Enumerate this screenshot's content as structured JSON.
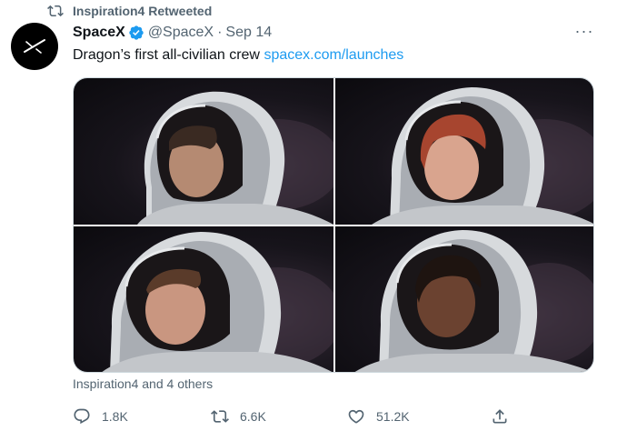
{
  "retweet": {
    "icon": "retweet-icon",
    "text": "Inspiration4 Retweeted"
  },
  "author": {
    "name": "SpaceX",
    "handle": "@SpaceX",
    "separator": "·",
    "date": "Sep 14",
    "verified_icon": "verified-badge-icon",
    "avatar_icon": "spacex-logo-icon"
  },
  "more": {
    "label": "···"
  },
  "tweet": {
    "text": "Dragon’s first all-civilian crew ",
    "link": "spacex.com/launches"
  },
  "media": {
    "photos": [
      "crew-photo-1",
      "crew-photo-2",
      "crew-photo-3",
      "crew-photo-4"
    ]
  },
  "liked_by": "Inspiration4 and 4 others",
  "actions": {
    "reply": {
      "icon": "reply-icon",
      "count": "1.8K"
    },
    "retweet": {
      "icon": "retweet-icon",
      "count": "6.6K"
    },
    "like": {
      "icon": "heart-icon",
      "count": "51.2K"
    },
    "share": {
      "icon": "share-icon"
    }
  },
  "colors": {
    "link": "#1d9bf0",
    "verified": "#1d9bf0",
    "secondary_text": "#536471",
    "primary_text": "#0f1419"
  }
}
